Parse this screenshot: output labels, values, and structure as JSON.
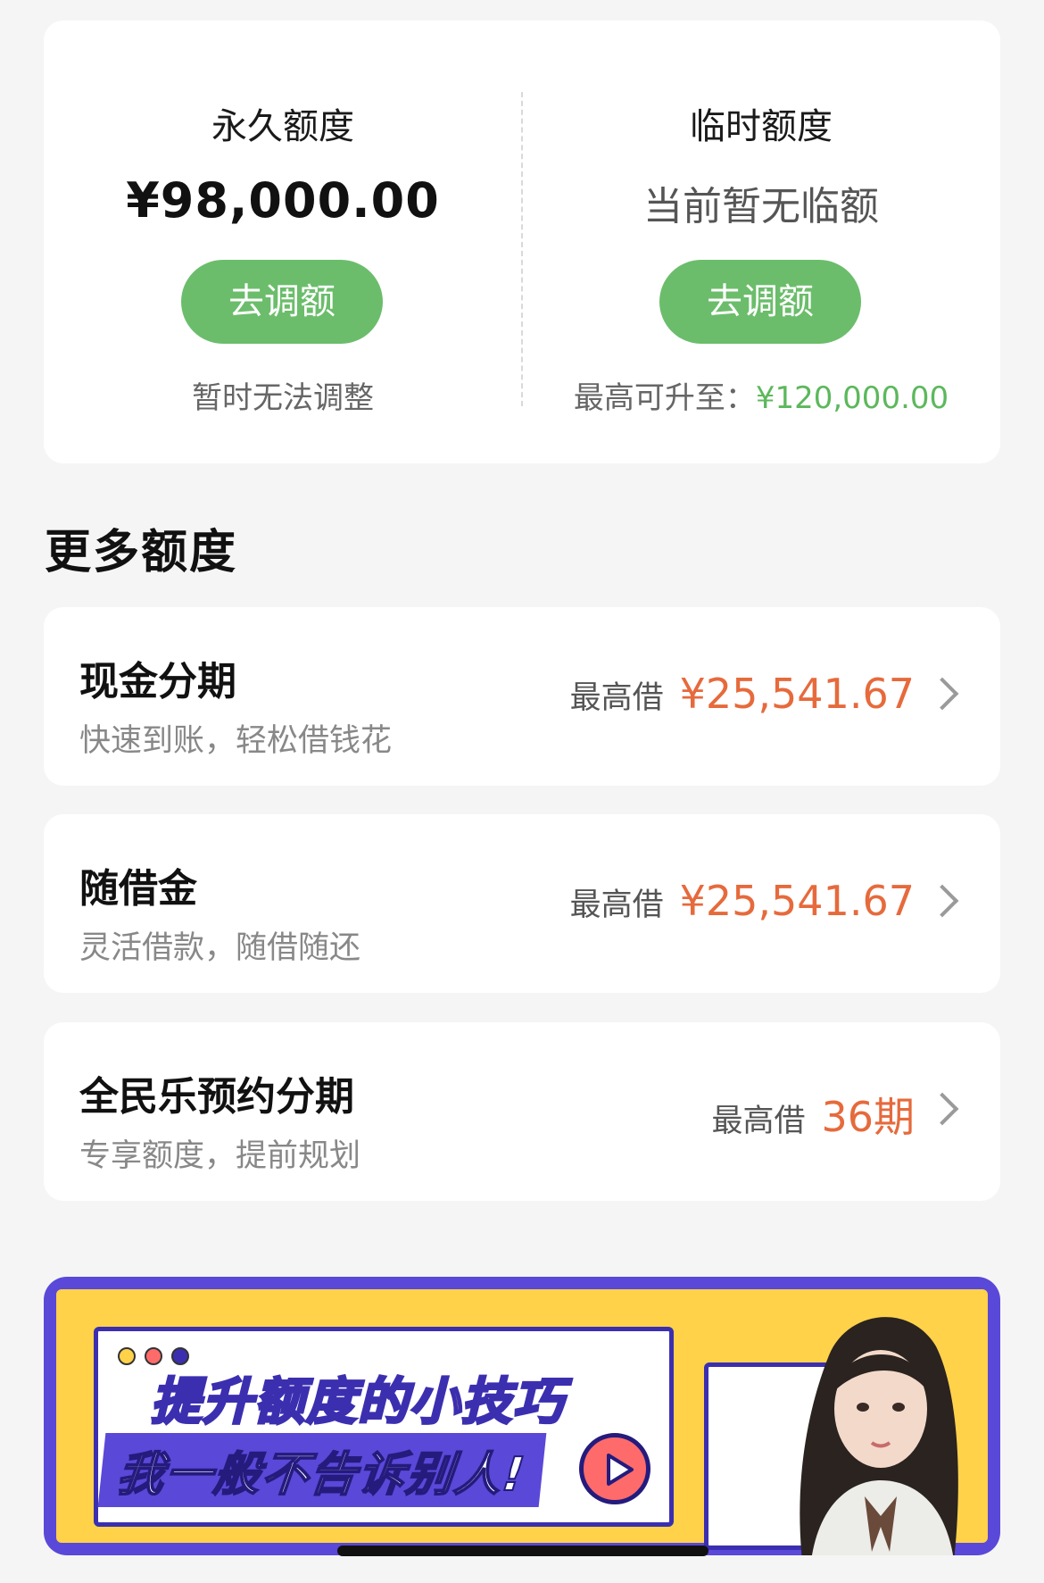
{
  "quota": {
    "permanent": {
      "title": "永久额度",
      "amount": "¥98,000.00",
      "button": "去调额",
      "note": "暂时无法调整"
    },
    "temporary": {
      "title": "临时额度",
      "status": "当前暂无临额",
      "button": "去调额",
      "note_label": "最高可升至：",
      "note_value": "¥120,000.00"
    }
  },
  "more_section": {
    "title": "更多额度",
    "items": [
      {
        "name": "现金分期",
        "desc": "快速到账，轻松借钱花",
        "prefix": "最高借",
        "value": "¥25,541.67"
      },
      {
        "name": "随借金",
        "desc": "灵活借款，随借随还",
        "prefix": "最高借",
        "value": "¥25,541.67"
      },
      {
        "name": "全民乐预约分期",
        "desc": "专享额度，提前规划",
        "prefix": "最高借",
        "value": "36期"
      }
    ]
  },
  "banner": {
    "line1": "提升额度的小技巧",
    "line2": "我一般不告诉别人!"
  },
  "colors": {
    "accent_green": "#6bbd6b",
    "amount_orange": "#e66a3c",
    "banner_purple": "#5a48d8",
    "banner_yellow": "#ffd24a"
  },
  "icons": {
    "chevron": "chevron-right-icon",
    "play": "play-icon"
  }
}
